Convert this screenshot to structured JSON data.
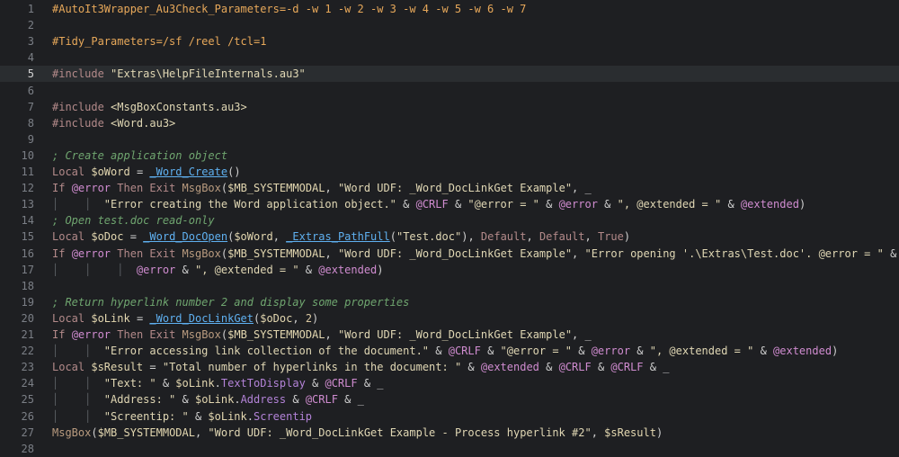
{
  "editor": {
    "current_line": 5,
    "lines": [
      {
        "n": "1",
        "tokens": [
          {
            "t": "#AutoIt3Wrapper_Au3Check_Parameters=-d -w 1 -w 2 -w 3 -w 4 -w 5 -w 6 -w 7",
            "c": "directive"
          }
        ]
      },
      {
        "n": "2",
        "tokens": []
      },
      {
        "n": "3",
        "tokens": [
          {
            "t": "#Tidy_Parameters=/sf /reel /tcl=1",
            "c": "directive"
          }
        ]
      },
      {
        "n": "4",
        "tokens": []
      },
      {
        "n": "5",
        "tokens": [
          {
            "t": "#include ",
            "c": "kw"
          },
          {
            "t": "\"Extras\\HelpFileInternals.au3\"",
            "c": "str"
          }
        ]
      },
      {
        "n": "6",
        "tokens": []
      },
      {
        "n": "7",
        "tokens": [
          {
            "t": "#include ",
            "c": "kw"
          },
          {
            "t": "<MsgBoxConstants.au3>",
            "c": "str"
          }
        ]
      },
      {
        "n": "8",
        "tokens": [
          {
            "t": "#include ",
            "c": "kw"
          },
          {
            "t": "<Word.au3>",
            "c": "str"
          }
        ]
      },
      {
        "n": "9",
        "tokens": []
      },
      {
        "n": "10",
        "tokens": [
          {
            "t": "; Create application object",
            "c": "comment"
          }
        ]
      },
      {
        "n": "11",
        "tokens": [
          {
            "t": "Local ",
            "c": "kw"
          },
          {
            "t": "$oWord",
            "c": "var"
          },
          {
            "t": " = ",
            "c": "op"
          },
          {
            "t": "_Word_Create",
            "c": "udf"
          },
          {
            "t": "()",
            "c": "op"
          }
        ]
      },
      {
        "n": "12",
        "tokens": [
          {
            "t": "If ",
            "c": "kw"
          },
          {
            "t": "@error",
            "c": "macro"
          },
          {
            "t": " Then Exit ",
            "c": "kw"
          },
          {
            "t": "MsgBox",
            "c": "func"
          },
          {
            "t": "(",
            "c": "op"
          },
          {
            "t": "$MB_SYSTEMMODAL",
            "c": "var"
          },
          {
            "t": ", ",
            "c": "op"
          },
          {
            "t": "\"Word UDF: _Word_DocLinkGet Example\"",
            "c": "str"
          },
          {
            "t": ", _",
            "c": "op"
          }
        ]
      },
      {
        "n": "13",
        "guide": "│    │  ",
        "tokens": [
          {
            "t": "\"Error creating the Word application object.\"",
            "c": "str"
          },
          {
            "t": " & ",
            "c": "op"
          },
          {
            "t": "@CRLF",
            "c": "macro"
          },
          {
            "t": " & ",
            "c": "op"
          },
          {
            "t": "\"@error = \"",
            "c": "str"
          },
          {
            "t": " & ",
            "c": "op"
          },
          {
            "t": "@error",
            "c": "macro"
          },
          {
            "t": " & ",
            "c": "op"
          },
          {
            "t": "\", @extended = \"",
            "c": "str"
          },
          {
            "t": " & ",
            "c": "op"
          },
          {
            "t": "@extended",
            "c": "macro"
          },
          {
            "t": ")",
            "c": "op"
          }
        ]
      },
      {
        "n": "14",
        "tokens": [
          {
            "t": "; Open test.doc read-only",
            "c": "comment"
          }
        ]
      },
      {
        "n": "15",
        "tokens": [
          {
            "t": "Local ",
            "c": "kw"
          },
          {
            "t": "$oDoc",
            "c": "var"
          },
          {
            "t": " = ",
            "c": "op"
          },
          {
            "t": "_Word_DocOpen",
            "c": "udf"
          },
          {
            "t": "(",
            "c": "op"
          },
          {
            "t": "$oWord",
            "c": "var"
          },
          {
            "t": ", ",
            "c": "op"
          },
          {
            "t": "_Extras_PathFull",
            "c": "udf"
          },
          {
            "t": "(",
            "c": "op"
          },
          {
            "t": "\"Test.doc\"",
            "c": "str"
          },
          {
            "t": "), ",
            "c": "op"
          },
          {
            "t": "Default",
            "c": "kw"
          },
          {
            "t": ", ",
            "c": "op"
          },
          {
            "t": "Default",
            "c": "kw"
          },
          {
            "t": ", ",
            "c": "op"
          },
          {
            "t": "True",
            "c": "kw"
          },
          {
            "t": ")",
            "c": "op"
          }
        ]
      },
      {
        "n": "16",
        "tokens": [
          {
            "t": "If ",
            "c": "kw"
          },
          {
            "t": "@error",
            "c": "macro"
          },
          {
            "t": " Then Exit ",
            "c": "kw"
          },
          {
            "t": "MsgBox",
            "c": "func"
          },
          {
            "t": "(",
            "c": "op"
          },
          {
            "t": "$MB_SYSTEMMODAL",
            "c": "var"
          },
          {
            "t": ", ",
            "c": "op"
          },
          {
            "t": "\"Word UDF: _Word_DocLinkGet Example\"",
            "c": "str"
          },
          {
            "t": ", ",
            "c": "op"
          },
          {
            "t": "\"Error opening '.\\Extras\\Test.doc'. @error = \"",
            "c": "str"
          },
          {
            "t": " & _",
            "c": "op"
          }
        ]
      },
      {
        "n": "17",
        "guide": "│    │    │  ",
        "tokens": [
          {
            "t": "@error",
            "c": "macro"
          },
          {
            "t": " & ",
            "c": "op"
          },
          {
            "t": "\", @extended = \"",
            "c": "str"
          },
          {
            "t": " & ",
            "c": "op"
          },
          {
            "t": "@extended",
            "c": "macro"
          },
          {
            "t": ")",
            "c": "op"
          }
        ]
      },
      {
        "n": "18",
        "tokens": []
      },
      {
        "n": "19",
        "tokens": [
          {
            "t": "; Return hyperlink number 2 and display some properties",
            "c": "comment"
          }
        ]
      },
      {
        "n": "20",
        "tokens": [
          {
            "t": "Local ",
            "c": "kw"
          },
          {
            "t": "$oLink",
            "c": "var"
          },
          {
            "t": " = ",
            "c": "op"
          },
          {
            "t": "_Word_DocLinkGet",
            "c": "udf"
          },
          {
            "t": "(",
            "c": "op"
          },
          {
            "t": "$oDoc",
            "c": "var"
          },
          {
            "t": ", ",
            "c": "op"
          },
          {
            "t": "2",
            "c": "num"
          },
          {
            "t": ")",
            "c": "op"
          }
        ]
      },
      {
        "n": "21",
        "tokens": [
          {
            "t": "If ",
            "c": "kw"
          },
          {
            "t": "@error",
            "c": "macro"
          },
          {
            "t": " Then Exit ",
            "c": "kw"
          },
          {
            "t": "MsgBox",
            "c": "func"
          },
          {
            "t": "(",
            "c": "op"
          },
          {
            "t": "$MB_SYSTEMMODAL",
            "c": "var"
          },
          {
            "t": ", ",
            "c": "op"
          },
          {
            "t": "\"Word UDF: _Word_DocLinkGet Example\"",
            "c": "str"
          },
          {
            "t": ", _",
            "c": "op"
          }
        ]
      },
      {
        "n": "22",
        "guide": "│    │  ",
        "tokens": [
          {
            "t": "\"Error accessing link collection of the document.\"",
            "c": "str"
          },
          {
            "t": " & ",
            "c": "op"
          },
          {
            "t": "@CRLF",
            "c": "macro"
          },
          {
            "t": " & ",
            "c": "op"
          },
          {
            "t": "\"@error = \"",
            "c": "str"
          },
          {
            "t": " & ",
            "c": "op"
          },
          {
            "t": "@error",
            "c": "macro"
          },
          {
            "t": " & ",
            "c": "op"
          },
          {
            "t": "\", @extended = \"",
            "c": "str"
          },
          {
            "t": " & ",
            "c": "op"
          },
          {
            "t": "@extended",
            "c": "macro"
          },
          {
            "t": ")",
            "c": "op"
          }
        ]
      },
      {
        "n": "23",
        "tokens": [
          {
            "t": "Local ",
            "c": "kw"
          },
          {
            "t": "$sResult",
            "c": "var"
          },
          {
            "t": " = ",
            "c": "op"
          },
          {
            "t": "\"Total number of hyperlinks in the document: \"",
            "c": "str"
          },
          {
            "t": " & ",
            "c": "op"
          },
          {
            "t": "@extended",
            "c": "macro"
          },
          {
            "t": " & ",
            "c": "op"
          },
          {
            "t": "@CRLF",
            "c": "macro"
          },
          {
            "t": " & ",
            "c": "op"
          },
          {
            "t": "@CRLF",
            "c": "macro"
          },
          {
            "t": " & _",
            "c": "op"
          }
        ]
      },
      {
        "n": "24",
        "guide": "│    │  ",
        "tokens": [
          {
            "t": "\"Text: \"",
            "c": "str"
          },
          {
            "t": " & ",
            "c": "op"
          },
          {
            "t": "$oLink",
            "c": "var"
          },
          {
            "t": ".",
            "c": "op"
          },
          {
            "t": "TextToDisplay",
            "c": "prop"
          },
          {
            "t": " & ",
            "c": "op"
          },
          {
            "t": "@CRLF",
            "c": "macro"
          },
          {
            "t": " & _",
            "c": "op"
          }
        ]
      },
      {
        "n": "25",
        "guide": "│    │  ",
        "tokens": [
          {
            "t": "\"Address: \"",
            "c": "str"
          },
          {
            "t": " & ",
            "c": "op"
          },
          {
            "t": "$oLink",
            "c": "var"
          },
          {
            "t": ".",
            "c": "op"
          },
          {
            "t": "Address",
            "c": "prop"
          },
          {
            "t": " & ",
            "c": "op"
          },
          {
            "t": "@CRLF",
            "c": "macro"
          },
          {
            "t": " & _",
            "c": "op"
          }
        ]
      },
      {
        "n": "26",
        "guide": "│    │  ",
        "tokens": [
          {
            "t": "\"Screentip: \"",
            "c": "str"
          },
          {
            "t": " & ",
            "c": "op"
          },
          {
            "t": "$oLink",
            "c": "var"
          },
          {
            "t": ".",
            "c": "op"
          },
          {
            "t": "Screentip",
            "c": "prop"
          }
        ]
      },
      {
        "n": "27",
        "tokens": [
          {
            "t": "MsgBox",
            "c": "func"
          },
          {
            "t": "(",
            "c": "op"
          },
          {
            "t": "$MB_SYSTEMMODAL",
            "c": "var"
          },
          {
            "t": ", ",
            "c": "op"
          },
          {
            "t": "\"Word UDF: _Word_DocLinkGet Example - Process hyperlink #2\"",
            "c": "str"
          },
          {
            "t": ", ",
            "c": "op"
          },
          {
            "t": "$sResult",
            "c": "var"
          },
          {
            "t": ")",
            "c": "op"
          }
        ]
      },
      {
        "n": "28",
        "tokens": []
      }
    ]
  }
}
